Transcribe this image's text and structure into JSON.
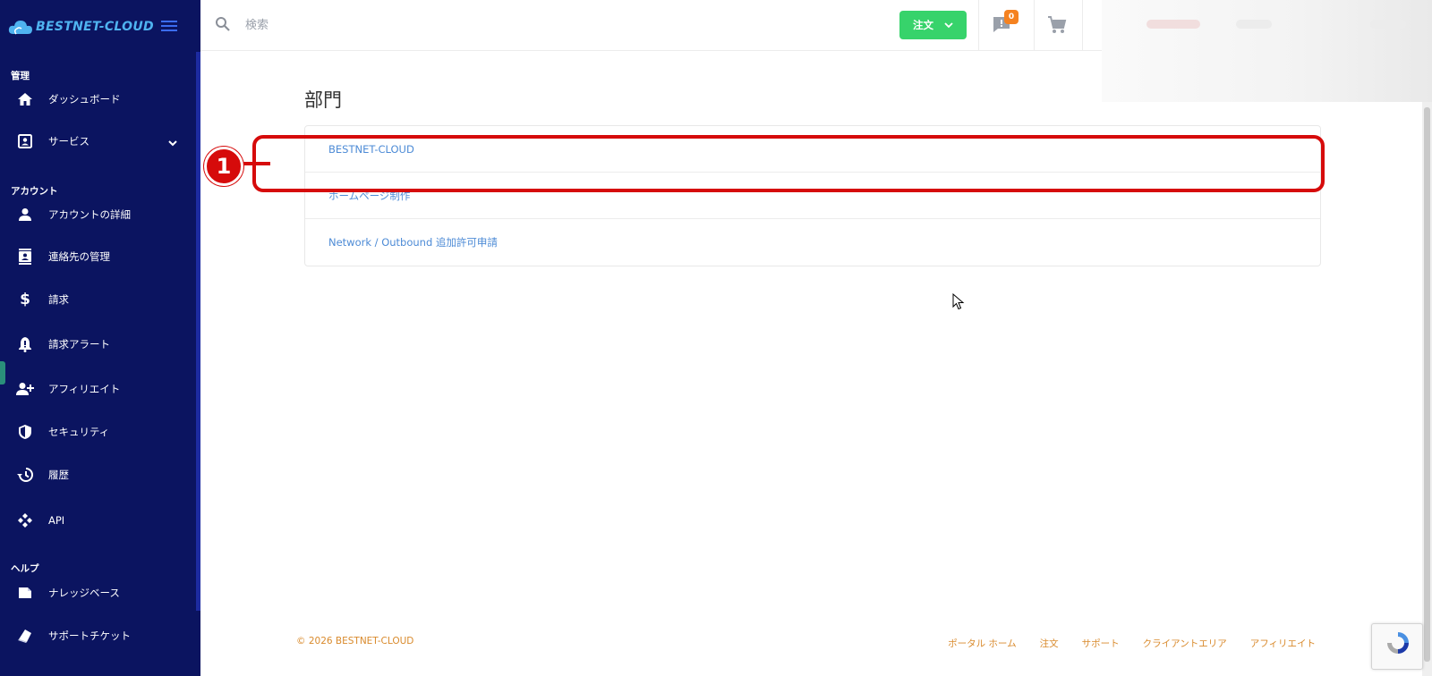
{
  "sidebar": {
    "logo_text": "BESTNET-CLOUD",
    "sections": {
      "manage": "管理",
      "account": "アカウント",
      "help": "ヘルプ"
    },
    "items": [
      {
        "label": "ダッシュボード",
        "icon": "home-icon"
      },
      {
        "label": "サービス",
        "icon": "service-icon"
      },
      {
        "label": "アカウントの詳細",
        "icon": "user-icon"
      },
      {
        "label": "連絡先の管理",
        "icon": "contacts-icon"
      },
      {
        "label": "請求",
        "icon": "dollar-icon"
      },
      {
        "label": "請求アラート",
        "icon": "bell-icon"
      },
      {
        "label": "アフィリエイト",
        "icon": "user-add-icon"
      },
      {
        "label": "セキュリティ",
        "icon": "shield-icon"
      },
      {
        "label": "履歴",
        "icon": "history-icon"
      },
      {
        "label": "API",
        "icon": "api-icon"
      },
      {
        "label": "ナレッジベース",
        "icon": "book-icon"
      },
      {
        "label": "サポートチケット",
        "icon": "ticket-icon"
      }
    ]
  },
  "topbar": {
    "search_placeholder": "検索",
    "order_label": "注文",
    "message_count": "0"
  },
  "main": {
    "title": "部門",
    "departments": [
      "BESTNET-CLOUD",
      "ホームページ制作",
      "Network / Outbound 追加許可申請"
    ]
  },
  "annotation": {
    "number": "1"
  },
  "footer": {
    "copyright": "© 2026 BESTNET-CLOUD",
    "links": [
      "ポータル ホーム",
      "注文",
      "サポート",
      "クライアントエリア",
      "アフィリエイト"
    ]
  },
  "colors": {
    "sidebar_bg": "#0b1460",
    "accent_green": "#37d36b",
    "link_blue": "#4d8bd6",
    "footer_orange": "#d98a2c",
    "annotation_red": "#d60b0b",
    "badge_orange": "#f58220"
  }
}
